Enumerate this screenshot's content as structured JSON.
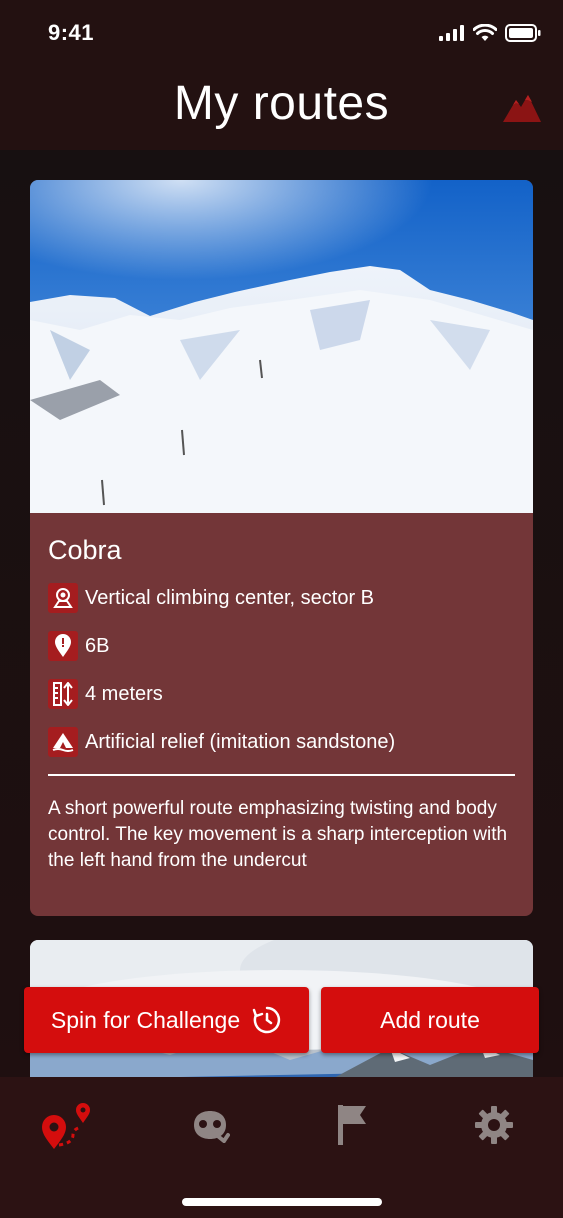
{
  "status_bar": {
    "time": "9:41"
  },
  "header": {
    "title": "My routes"
  },
  "route_card": {
    "name": "Cobra",
    "location": "Vertical climbing center, sector B",
    "grade": "6B",
    "length": "4 meters",
    "relief": "Artificial relief (imitation sandstone)",
    "description": "A short powerful route emphasizing twisting and body control. The key movement is a sharp interception with the left hand from the undercut"
  },
  "actions": {
    "spin_label": "Spin for Challenge",
    "add_label": "Add route"
  },
  "tab_bar": {
    "tabs": [
      "routes-icon",
      "climber-icon",
      "flag-icon",
      "settings-icon"
    ],
    "active": "routes-icon"
  },
  "colors": {
    "accent": "#d40d0d",
    "card_bg": "#733638",
    "icon_bg": "#a51d1f"
  }
}
